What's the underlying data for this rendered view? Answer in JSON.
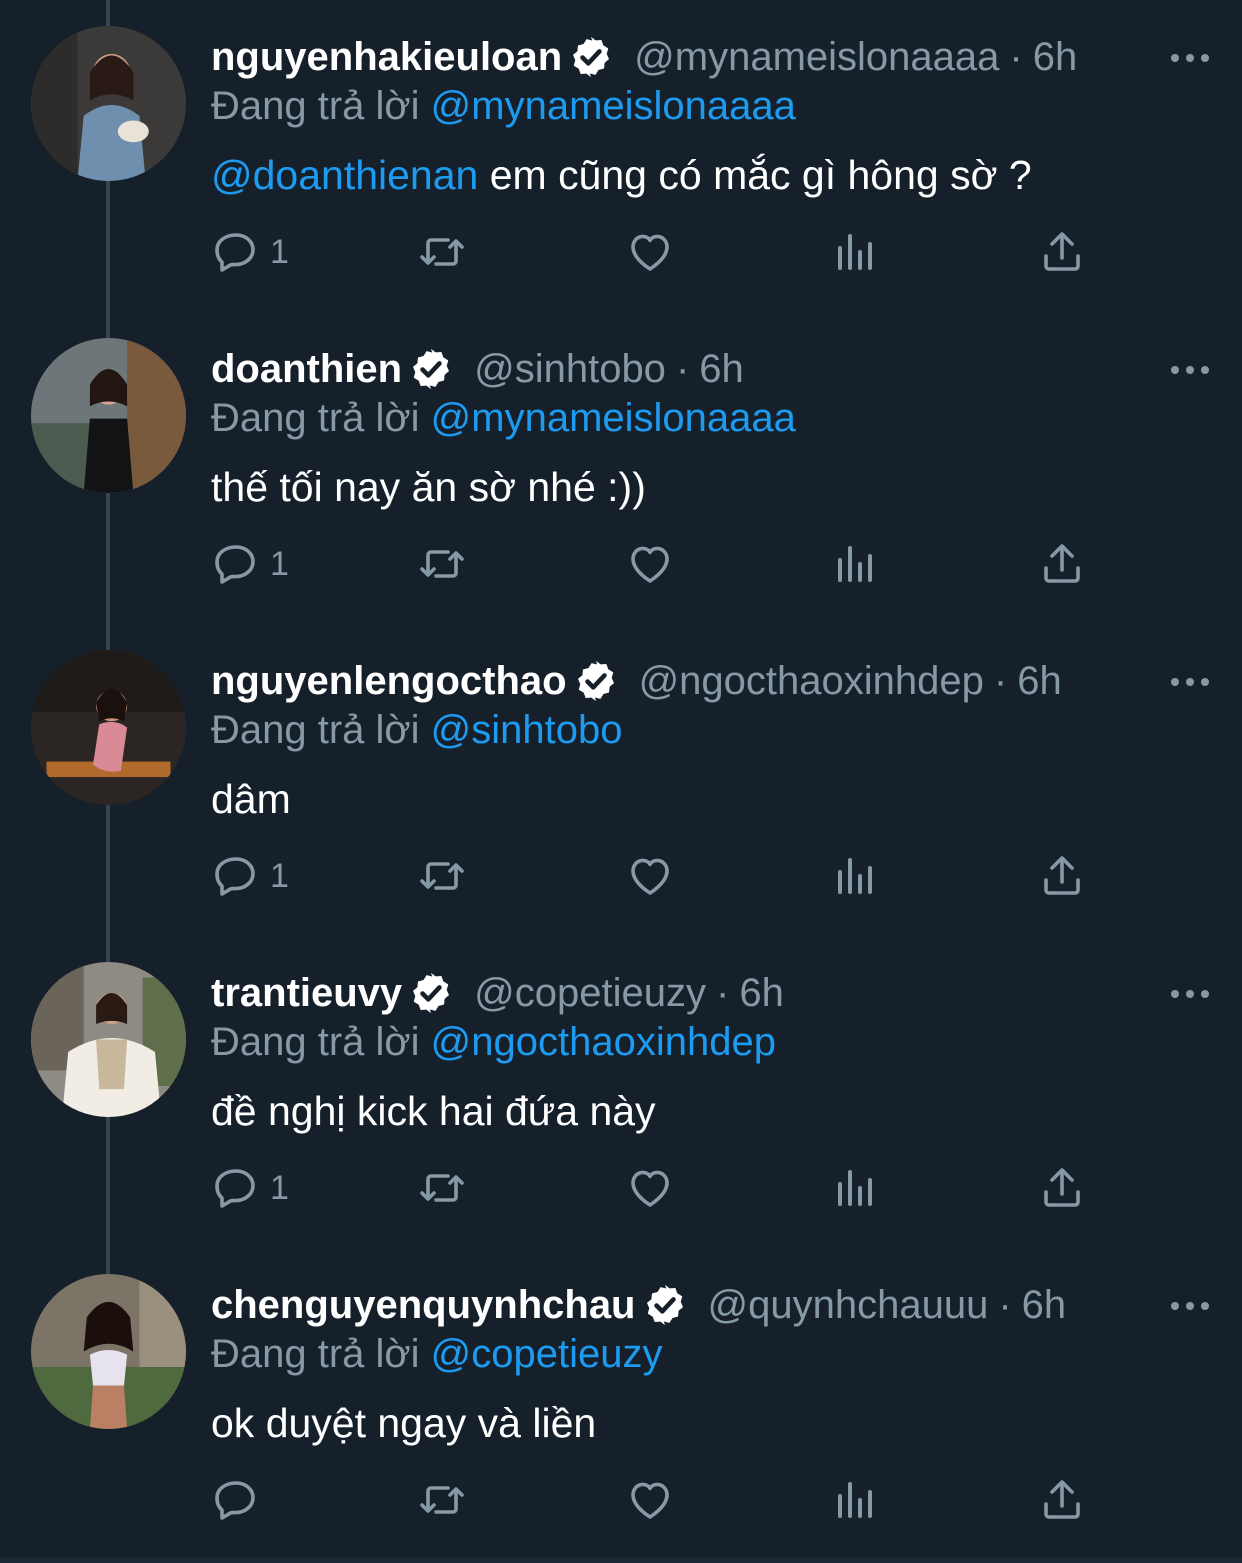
{
  "colors": {
    "background": "#15202b",
    "secondary_text": "#8899a6",
    "accent": "#1d9bf0",
    "thread_line": "#38444d"
  },
  "replying_prefix": "Đang trả lời",
  "tweets": [
    {
      "display_name": "nguyenhakieuloan",
      "handle": "@mynameislonaaaa",
      "separator": "·",
      "time": "6h",
      "reply_to": "@mynameislonaaaa",
      "mention": "@doanthienan",
      "text": " em cũng có mắc gì hông sờ ?",
      "reply_count": "1",
      "verified": true
    },
    {
      "display_name": "doanthien",
      "handle": "@sinhtobo",
      "separator": "·",
      "time": "6h",
      "reply_to": "@mynameislonaaaa",
      "mention": "",
      "text": "thế tối nay ăn sờ nhé :))",
      "reply_count": "1",
      "verified": true
    },
    {
      "display_name": "nguyenlengocthao",
      "handle": "@ngocthaoxinhdep",
      "separator": "·",
      "time": "6h",
      "reply_to": "@sinhtobo",
      "mention": "",
      "text": "dâm",
      "reply_count": "1",
      "verified": true
    },
    {
      "display_name": "trantieuvy",
      "handle": "@copetieuzy",
      "separator": "·",
      "time": "6h",
      "reply_to": "@ngocthaoxinhdep",
      "mention": "",
      "text": "đề nghị kick hai đứa này",
      "reply_count": "1",
      "verified": true
    },
    {
      "display_name": "chenguyenquynhchau",
      "handle": "@quynhchauuu",
      "separator": "·",
      "time": "6h",
      "reply_to": "@copetieuzy",
      "mention": "",
      "text": "ok duyệt ngay và liền",
      "reply_count": "",
      "verified": true
    }
  ],
  "icons": {
    "reply": "speech-bubble-icon",
    "retweet": "retweet-icon",
    "like": "heart-icon",
    "analytics": "bar-chart-icon",
    "share": "share-upload-icon",
    "more": "more-dots-icon",
    "verified": "verified-badge-icon"
  }
}
